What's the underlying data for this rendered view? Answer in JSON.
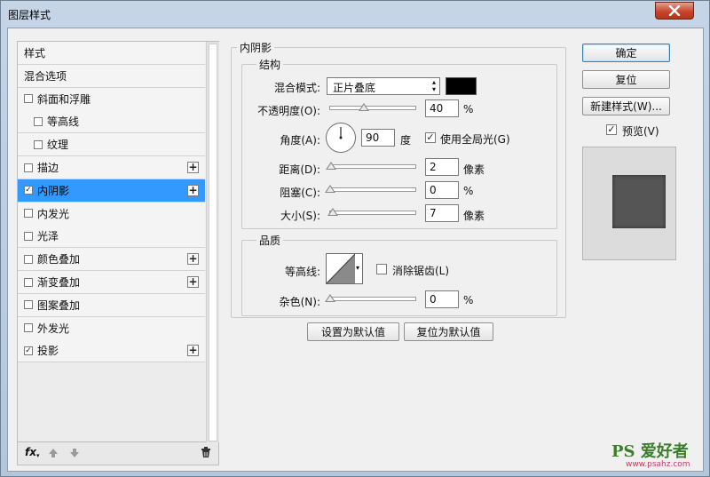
{
  "window": {
    "title": "图层样式"
  },
  "left_panel": {
    "items": [
      {
        "label": "样式",
        "checkbox": false,
        "checked": false,
        "plus": false,
        "active": false,
        "indent": false
      },
      {
        "label": "混合选项",
        "checkbox": false,
        "checked": false,
        "plus": false,
        "active": false,
        "indent": false
      },
      {
        "label": "斜面和浮雕",
        "checkbox": true,
        "checked": false,
        "plus": false,
        "active": false,
        "indent": false
      },
      {
        "label": "等高线",
        "checkbox": true,
        "checked": false,
        "plus": false,
        "active": false,
        "indent": true
      },
      {
        "label": "纹理",
        "checkbox": true,
        "checked": false,
        "plus": false,
        "active": false,
        "indent": true
      },
      {
        "label": "描边",
        "checkbox": true,
        "checked": false,
        "plus": true,
        "active": false,
        "indent": false
      },
      {
        "label": "内阴影",
        "checkbox": true,
        "checked": true,
        "plus": true,
        "active": true,
        "indent": false
      },
      {
        "label": "内发光",
        "checkbox": true,
        "checked": false,
        "plus": false,
        "active": false,
        "indent": false
      },
      {
        "label": "光泽",
        "checkbox": true,
        "checked": false,
        "plus": false,
        "active": false,
        "indent": false
      },
      {
        "label": "颜色叠加",
        "checkbox": true,
        "checked": false,
        "plus": true,
        "active": false,
        "indent": false
      },
      {
        "label": "渐变叠加",
        "checkbox": true,
        "checked": false,
        "plus": true,
        "active": false,
        "indent": false
      },
      {
        "label": "图案叠加",
        "checkbox": true,
        "checked": false,
        "plus": false,
        "active": false,
        "indent": false
      },
      {
        "label": "外发光",
        "checkbox": true,
        "checked": false,
        "plus": false,
        "active": false,
        "indent": false
      },
      {
        "label": "投影",
        "checkbox": true,
        "checked": true,
        "plus": true,
        "active": false,
        "indent": false
      }
    ],
    "footer": {
      "fx_label": "fx"
    }
  },
  "inner_shadow": {
    "title": "内阴影",
    "structure": {
      "title": "结构",
      "blend_mode_label": "混合模式:",
      "blend_mode_value": "正片叠底",
      "blend_color": "#000000",
      "opacity_label": "不透明度(O):",
      "opacity_value": "40",
      "opacity_unit": "%",
      "opacity_fraction": 0.4,
      "angle_label": "角度(A):",
      "angle_value": "90",
      "angle_unit": "度",
      "global_light_label": "使用全局光(G)",
      "global_light_checked": true,
      "distance_label": "距离(D):",
      "distance_value": "2",
      "distance_unit": "像素",
      "distance_fraction": 0.01,
      "choke_label": "阻塞(C):",
      "choke_value": "0",
      "choke_unit": "%",
      "choke_fraction": 0.0,
      "size_label": "大小(S):",
      "size_value": "7",
      "size_unit": "像素",
      "size_fraction": 0.03
    },
    "quality": {
      "title": "品质",
      "contour_label": "等高线:",
      "anti_alias_label": "消除锯齿(L)",
      "anti_alias_checked": false,
      "noise_label": "杂色(N):",
      "noise_value": "0",
      "noise_unit": "%",
      "noise_fraction": 0.0
    },
    "set_default_label": "设置为默认值",
    "reset_default_label": "复位为默认值"
  },
  "right_panel": {
    "ok_label": "确定",
    "reset_label": "复位",
    "new_style_label": "新建样式(W)...",
    "preview_label": "预览(V)",
    "preview_checked": true
  },
  "watermark": {
    "text": "PS 爱好者",
    "url": "www.psahz.com"
  },
  "colors": {
    "active_item": "#3399ff",
    "swatch": "#000000",
    "preview_square": "#555555"
  }
}
